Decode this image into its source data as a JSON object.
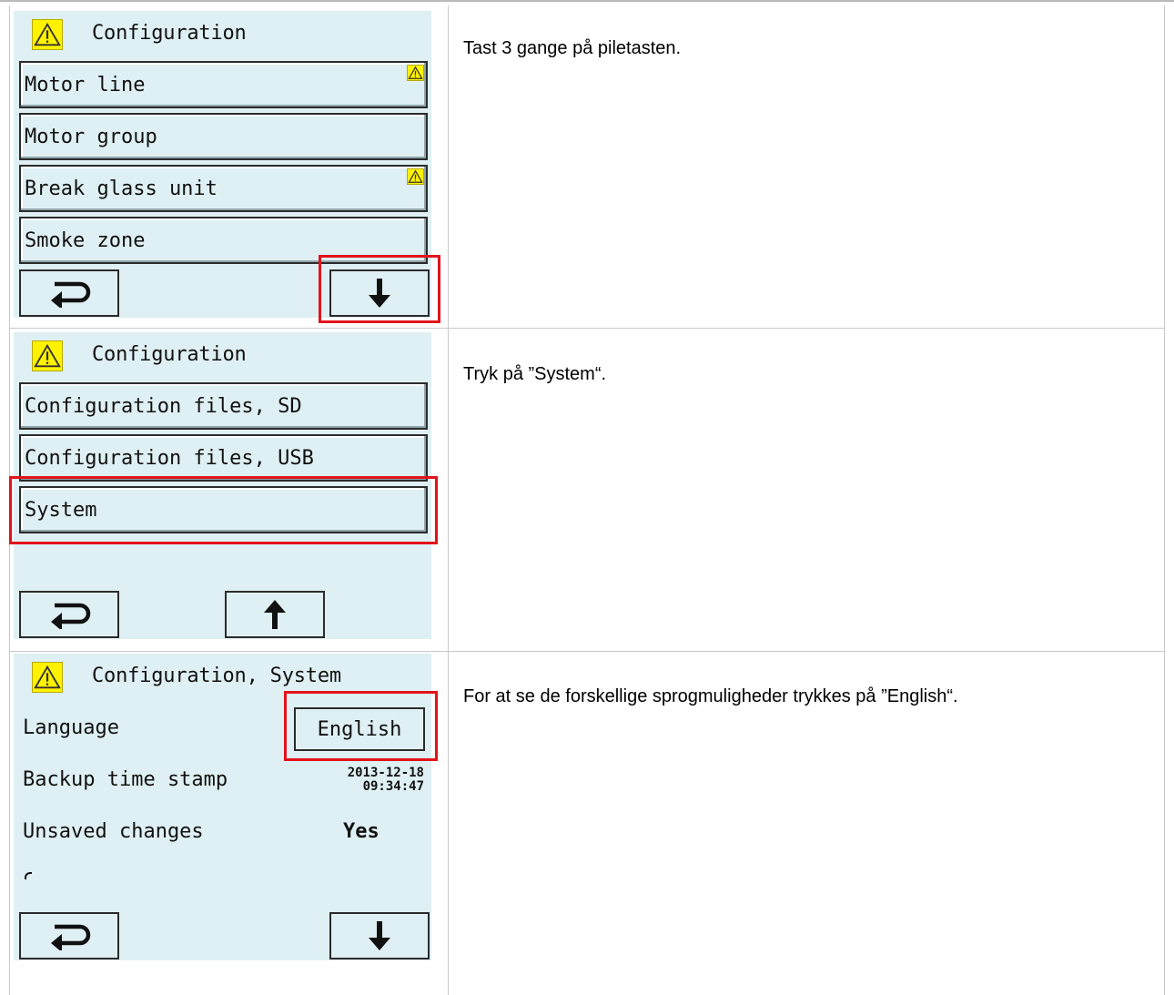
{
  "step1": {
    "title": "Configuration",
    "items": [
      {
        "label": "Motor line",
        "warning": true
      },
      {
        "label": "Motor group",
        "warning": false
      },
      {
        "label": "Break glass unit",
        "warning": true
      },
      {
        "label": "Smoke zone",
        "warning": false
      }
    ],
    "back_icon": "return-arrow-icon",
    "nav_icon": "arrow-down-icon",
    "instruction": "Tast 3 gange på piletasten."
  },
  "step2": {
    "title": "Configuration",
    "items": [
      {
        "label": "Configuration files, SD"
      },
      {
        "label": "Configuration files, USB"
      },
      {
        "label": "System"
      }
    ],
    "back_icon": "return-arrow-icon",
    "nav_icon": "arrow-up-icon",
    "instruction": "Tryk på ”System“."
  },
  "step3": {
    "title": "Configuration, System",
    "language_label": "Language",
    "language_value": "English",
    "backup_label": "Backup time stamp",
    "backup_date": "2013-12-18",
    "backup_time": "09:34:47",
    "unsaved_label": "Unsaved changes",
    "unsaved_value": "Yes",
    "back_icon": "return-arrow-icon",
    "nav_icon": "arrow-down-icon",
    "instruction": "For at se de forskellige sprogmuligheder trykkes på ”English“."
  },
  "colors": {
    "screen_bg": "#dff0f4",
    "warning": "#fff200",
    "highlight": "#e2141b",
    "grid": "#c9c9c9"
  }
}
